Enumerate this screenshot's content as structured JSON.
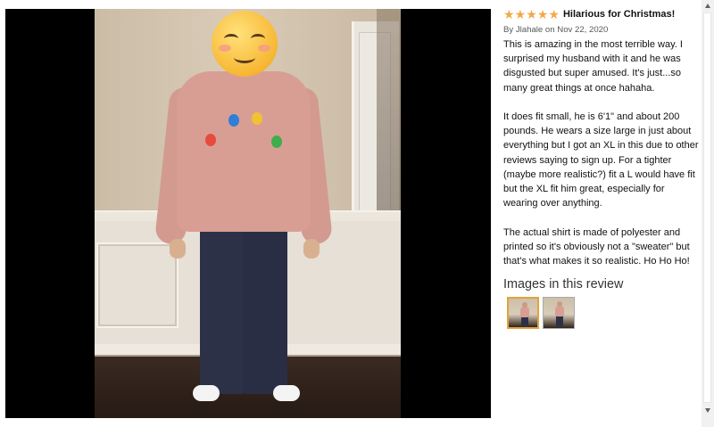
{
  "review": {
    "rating_stars": [
      "★",
      "★",
      "★",
      "★",
      "★"
    ],
    "title": "Hilarious for Christmas!",
    "byline": "By Jlahale on Nov 22, 2020",
    "paragraphs": [
      "This is amazing in the most terrible way. I surprised my husband with it and he was disgusted but super amused. It's just...so many great things at once hahaha.",
      "It does fit small, he is 6'1\" and about 200 pounds. He wears a size large in just about everything but I got an XL in this due to other reviews saying to sign up. For a tighter (maybe more realistic?) fit a L would have fit but the XL fit him great, especially for wearing over anything.",
      "The actual shirt is made of polyester and printed so it's obviously not a \"sweater\" but that's what makes it so realistic. Ho Ho Ho!"
    ],
    "images_heading": "Images in this review",
    "thumbnails_selected_index": 0
  },
  "colors": {
    "star": "#f3a847",
    "selected_thumb_border": "#e4a23f"
  }
}
